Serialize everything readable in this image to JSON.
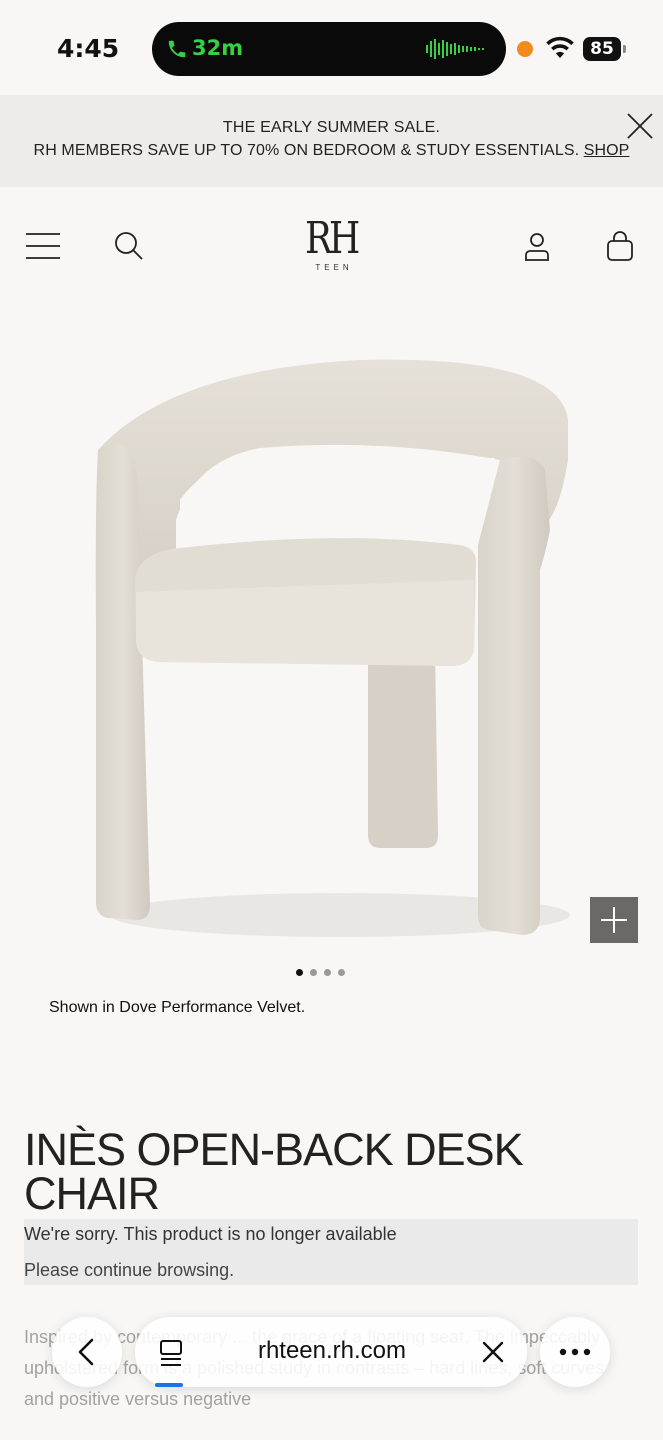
{
  "status_bar": {
    "time": "4:45",
    "call_duration": "32m",
    "battery_level": "85",
    "colors": {
      "call": "#35d046",
      "recording_dot": "#f28a1e"
    }
  },
  "promo": {
    "line1": "THE EARLY SUMMER SALE.",
    "line2": "RH MEMBERS SAVE UP TO 70% ON BEDROOM & STUDY ESSENTIALS.",
    "link": "SHOP"
  },
  "header": {
    "logo_main": "RH",
    "logo_sub": "TEEN"
  },
  "product": {
    "image_dots": {
      "count": 4,
      "active": 1
    },
    "caption": "Shown in Dove Performance Velvet.",
    "title": "INÈS OPEN-BACK DESK CHAIR",
    "unavailable": "We're sorry. This product is no longer available",
    "continue": "Please continue browsing.",
    "description": "Inspired by contemporary ... the grace of a floating seat. The impeccably upholstered form is a polished study in contrasts – hard lines, soft curves and positive versus negative"
  },
  "browser": {
    "url": "rhteen.rh.com",
    "accent": "#1a73e8"
  }
}
